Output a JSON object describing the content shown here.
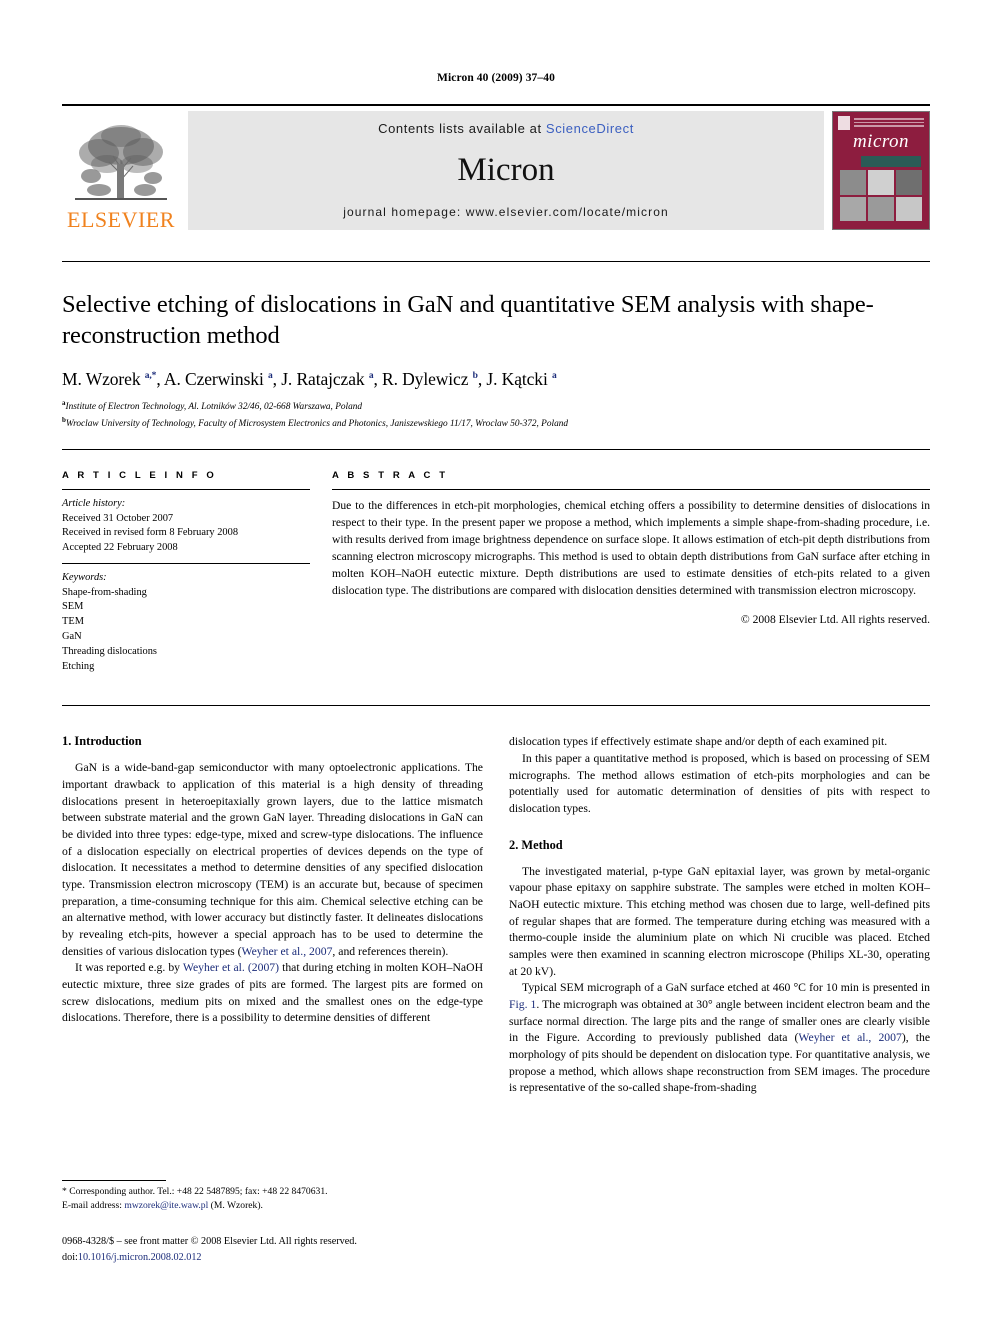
{
  "running_head": "Micron 40 (2009) 37–40",
  "masthead": {
    "publisher": "ELSEVIER",
    "contents_prefix": "Contents lists available at",
    "sciencedirect": "ScienceDirect",
    "journal_name": "Micron",
    "homepage": "journal homepage: www.elsevier.com/locate/micron",
    "cover_title": "micron",
    "accent_orange": "#F0821E",
    "link_blue": "#3b5fc0",
    "cover_maroon": "#8d1d3f"
  },
  "article": {
    "title": "Selective etching of dislocations in GaN and quantitative SEM analysis with shape-reconstruction method",
    "authors_html": "M. Wzorek <sup>a,*</sup>, A. Czerwinski <sup>a</sup>, J. Ratajczak <sup>a</sup>, R. Dylewicz <sup>b</sup>, J. K&#261;tcki <sup>a</sup>",
    "affiliations": [
      "Institute of Electron Technology, Al. Lotników 32/46, 02-668 Warszawa, Poland",
      "Wroclaw University of Technology, Faculty of Microsystem Electronics and Photonics, Janiszewskiego 11/17, Wroclaw 50-372, Poland"
    ],
    "affiliation_marks": [
      "a",
      "b"
    ]
  },
  "article_info": {
    "label": "A R T I C L E   I N F O",
    "history_heading": "Article history:",
    "history": [
      "Received 31 October 2007",
      "Received in revised form 8 February 2008",
      "Accepted 22 February 2008"
    ],
    "keywords_heading": "Keywords:",
    "keywords": [
      "Shape-from-shading",
      "SEM",
      "TEM",
      "GaN",
      "Threading dislocations",
      "Etching"
    ]
  },
  "abstract": {
    "label": "A B S T R A C T",
    "text": "Due to the differences in etch-pit morphologies, chemical etching offers a possibility to determine densities of dislocations in respect to their type. In the present paper we propose a method, which implements a simple shape-from-shading procedure, i.e. with results derived from image brightness dependence on surface slope. It allows estimation of etch-pit depth distributions from scanning electron microscopy micrographs. This method is used to obtain depth distributions from GaN surface after etching in molten KOH–NaOH eutectic mixture. Depth distributions are used to estimate densities of etch-pits related to a given dislocation type. The distributions are compared with dislocation densities determined with transmission electron microscopy.",
    "copyright": "© 2008 Elsevier Ltd. All rights reserved."
  },
  "body": {
    "section1_heading": "1. Introduction",
    "section1_p1_html": "GaN is a wide-band-gap semiconductor with many optoelectronic applications. The important drawback to application of this material is a high density of threading dislocations present in heteroepitaxially grown layers, due to the lattice mismatch between substrate material and the grown GaN layer. Threading dislocations in GaN can be divided into three types: edge-type, mixed and screw-type dislocations. The influence of a dislocation especially on electrical properties of devices depends on the type of dislocation. It necessitates a method to determine densities of any specified dislocation type. Transmission electron microscopy (TEM) is an accurate but, because of specimen preparation, a time-consuming technique for this aim. Chemical selective etching can be an alternative method, with lower accuracy but distinctly faster. It delineates dislocations by revealing etch-pits, however a special approach has to be used to determine the densities of various dislocation types (<a class=\"ref\" href=\"#\">Weyher et al., 2007</a>, and references therein).",
    "section1_p2_html": "It was reported e.g. by <a class=\"ref\" href=\"#\">Weyher et al. (2007)</a> that during etching in molten KOH–NaOH eutectic mixture, three size grades of pits are formed. The largest pits are formed on screw dislocations, medium pits on mixed and the smallest ones on the edge-type dislocations. Therefore, there is a possibility to determine densities of different",
    "section1_p3_html": "dislocation types if effectively estimate shape and/or depth of each examined pit.",
    "section1_p4_html": "In this paper a quantitative method is proposed, which is based on processing of SEM micrographs. The method allows estimation of etch-pits morphologies and can be potentially used for automatic determination of densities of pits with respect to dislocation types.",
    "section2_heading": "2. Method",
    "section2_p1_html": "The investigated material, p-type GaN epitaxial layer, was grown by metal-organic vapour phase epitaxy on sapphire substrate. The samples were etched in molten KOH–NaOH eutectic mixture. This etching method was chosen due to large, well-defined pits of regular shapes that are formed. The temperature during etching was measured with a thermo-couple inside the aluminium plate on which Ni crucible was placed. Etched samples were then examined in scanning electron microscope (Philips XL-30, operating at 20 kV).",
    "section2_p2_html": "Typical SEM micrograph of a GaN surface etched at 460 °C for 10 min is presented in <a class=\"ref\" href=\"#\">Fig. 1</a>. The micrograph was obtained at 30° angle between incident electron beam and the surface normal direction. The large pits and the range of smaller ones are clearly visible in the Figure. According to previously published data (<a class=\"ref\" href=\"#\">Weyher et al., 2007</a>), the morphology of pits should be dependent on dislocation type. For quantitative analysis, we propose a method, which allows shape reconstruction from SEM images. The procedure is representative of the so-called shape-from-shading"
  },
  "footer": {
    "corresponding_html": "* Corresponding author. Tel.: +48 22 5487895; fax: +48 22 8470631.",
    "email_prefix": "E-mail address:",
    "email": "mwzorek@ite.waw.pl",
    "email_suffix": "(M. Wzorek).",
    "front_matter": "0968-4328/$ – see front matter © 2008 Elsevier Ltd. All rights reserved.",
    "doi_label": "doi:",
    "doi": "10.1016/j.micron.2008.02.012"
  }
}
